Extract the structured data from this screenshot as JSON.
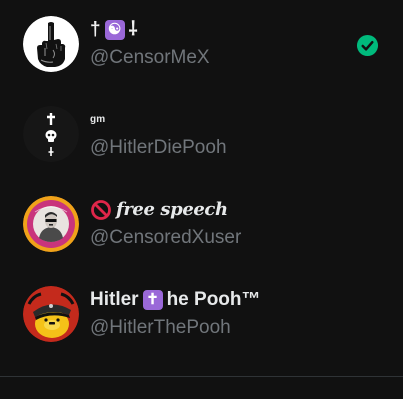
{
  "accounts": [
    {
      "name_prefix": "†",
      "name_emoji": "☯",
      "name_suffix": "⸸",
      "handle": "@CensorMeX",
      "avatar_icon": "middle-finger-hand-icon",
      "selected": true,
      "colors": {
        "avatar_bg": "#ffffff",
        "check": "#00ba7c"
      }
    },
    {
      "name": "gm",
      "handle": "@HitlerDiePooh",
      "avatar_icon": "cross-skull-cross-icon"
    },
    {
      "name_icon": "prohibited-icon",
      "name": "free speech",
      "handle": "@CensoredXuser",
      "avatar_icon": "censored-portrait-icon",
      "colors": {
        "ring_outer": "#f0a21a",
        "ring_inner": "#c9347c"
      }
    },
    {
      "name_prefix": "Hitler ",
      "name_emoji": "✝",
      "name_suffix": "he Pooh™",
      "handle": "@HitlerThePooh",
      "avatar_icon": "pooh-bear-with-cap-icon",
      "colors": {
        "avatar_bg": "#c42a1c",
        "bear": "#f5c218"
      }
    }
  ],
  "colors": {
    "background": "#111111",
    "text_primary": "#e7e9ea",
    "text_secondary": "#71767b",
    "divider": "#2f3336",
    "emoji_box": "#9a68d8"
  }
}
